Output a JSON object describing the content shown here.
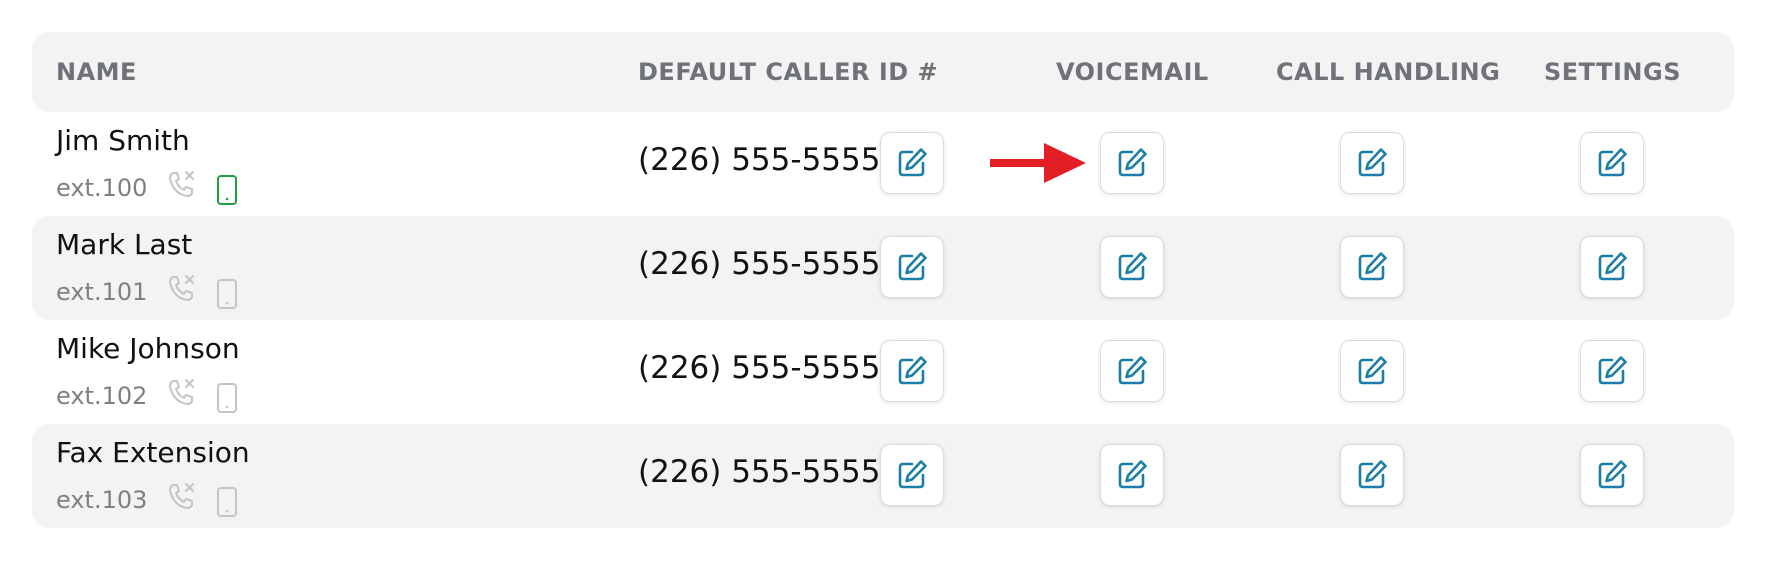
{
  "header": {
    "name": "NAME",
    "caller_id": "DEFAULT CALLER ID #",
    "voicemail": "VOICEMAIL",
    "call_handling": "CALL HANDLING",
    "settings": "SETTINGS"
  },
  "rows": [
    {
      "name": "Jim Smith",
      "ext": "ext.100",
      "caller_id": "(226) 555-5555",
      "mobile_active": true
    },
    {
      "name": "Mark Last",
      "ext": "ext.101",
      "caller_id": "(226) 555-5555",
      "mobile_active": false
    },
    {
      "name": "Mike Johnson",
      "ext": "ext.102",
      "caller_id": "(226) 555-5555",
      "mobile_active": false
    },
    {
      "name": "Fax Extension",
      "ext": "ext.103",
      "caller_id": "(226) 555-5555",
      "mobile_active": false
    }
  ],
  "icons": {
    "phone": "phone-missed-icon",
    "mobile": "mobile-phone-icon",
    "edit": "edit-icon",
    "annotation": "red-arrow-icon"
  },
  "colors": {
    "accent": "#1a7ea8",
    "mobile_active": "#1e9e3e",
    "mobile_inactive": "#c4c4c4",
    "annotation_arrow": "#e31e24",
    "row_shade": "#f3f3f3",
    "header_text": "#70727a"
  }
}
